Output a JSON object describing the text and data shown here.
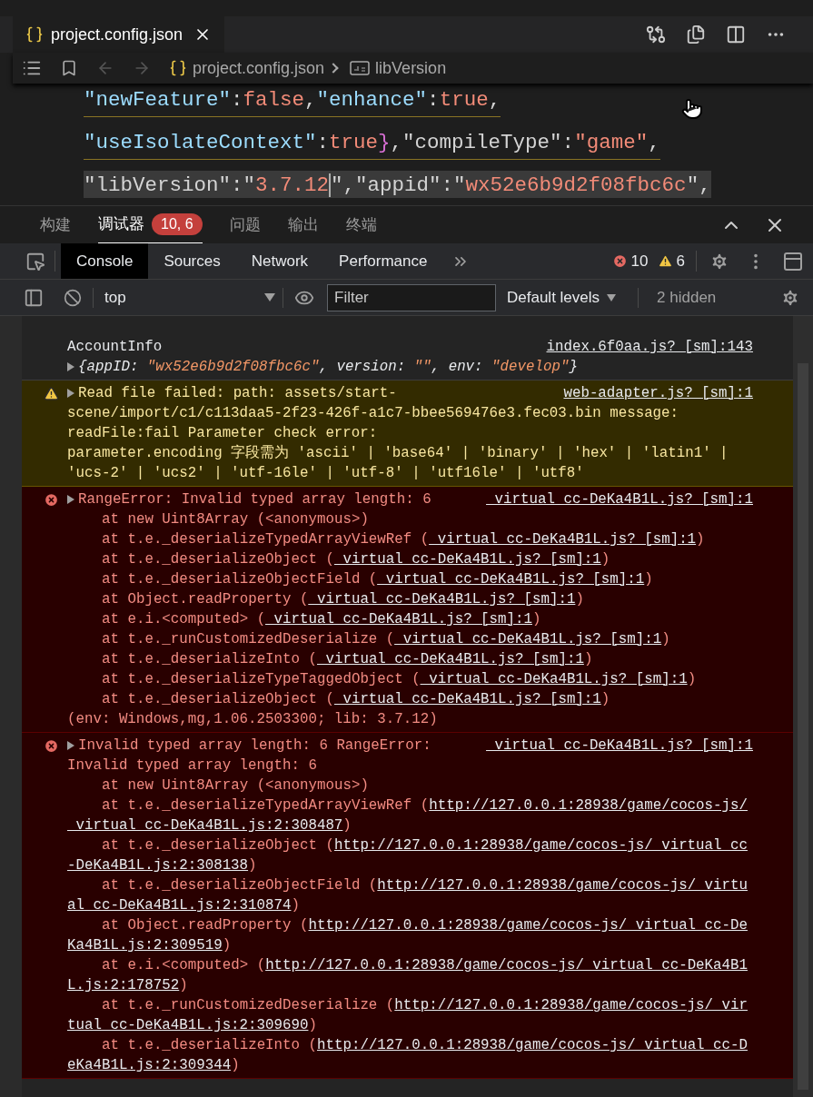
{
  "editor_tab": {
    "label": "project.config.json",
    "selected": true
  },
  "breadcrumb": {
    "file": "project.config.json",
    "symbol": "libVersion"
  },
  "code_lines": [
    {
      "highlighted": false,
      "tokens": [
        {
          "kind": "key",
          "text": "\"newFeature\""
        },
        {
          "kind": "punct",
          "text": ":"
        },
        {
          "kind": "value",
          "text": "false"
        },
        {
          "kind": "punct",
          "text": ","
        },
        {
          "kind": "key",
          "text": "\"enhance\""
        },
        {
          "kind": "punct",
          "text": ":"
        },
        {
          "kind": "value",
          "text": "true"
        },
        {
          "kind": "punct",
          "text": ","
        }
      ]
    },
    {
      "highlighted": false,
      "tokens": [
        {
          "kind": "key",
          "text": "\"useIsolateContext\""
        },
        {
          "kind": "punct",
          "text": ":"
        },
        {
          "kind": "value",
          "text": "true"
        },
        {
          "kind": "brace",
          "text": "}"
        },
        {
          "kind": "punct",
          "text": ",\"compileType\":"
        },
        {
          "kind": "value",
          "text": "\"game\""
        },
        {
          "kind": "punct",
          "text": ","
        }
      ]
    },
    {
      "highlighted": true,
      "tokens": [
        {
          "kind": "punct",
          "text": "\"libVersion\":\""
        },
        {
          "kind": "value",
          "text": "3.7.12",
          "cursor": true
        },
        {
          "kind": "punct",
          "text": "\",\"appid\":\""
        },
        {
          "kind": "value",
          "text": "wx52e6b9d2f08fbc6c"
        },
        {
          "kind": "punct",
          "text": "\","
        }
      ]
    }
  ],
  "panel_tabs": [
    {
      "label": "构建",
      "selected": false
    },
    {
      "label": "调试器",
      "selected": true,
      "badge": "10, 6"
    },
    {
      "label": "问题",
      "selected": false
    },
    {
      "label": "输出",
      "selected": false
    },
    {
      "label": "终端",
      "selected": false
    }
  ],
  "devtools_tabs": [
    {
      "label": "Console",
      "selected": true
    },
    {
      "label": "Sources",
      "selected": false
    },
    {
      "label": "Network",
      "selected": false
    },
    {
      "label": "Performance",
      "selected": false
    }
  ],
  "counts": {
    "errors": "10",
    "warnings": "6"
  },
  "filter_bar": {
    "context": "top",
    "filter_placeholder": "Filter",
    "levels": "Default levels",
    "hidden": "2 hidden"
  },
  "messages": [
    {
      "kind": "log",
      "text": "AccountInfo",
      "source": "index.6f0aa.js? [sm]:143",
      "object": [
        {
          "kind": "plain",
          "text": "{appID: "
        },
        {
          "kind": "string",
          "text": "\"wx52e6b9d2f08fbc6c\""
        },
        {
          "kind": "plain",
          "text": ", version: "
        },
        {
          "kind": "string",
          "text": "\"\""
        },
        {
          "kind": "plain",
          "text": ", env: "
        },
        {
          "kind": "string",
          "text": "\"develop\""
        },
        {
          "kind": "plain",
          "text": "}"
        }
      ]
    },
    {
      "kind": "warning",
      "text": "Read file failed: path: assets/start-",
      "continuation": "scene/import/c1/c113daa5-2f23-426f-a1c7-bbee569476e3.fec03.bin message:\nreadFile:fail Parameter check error:\nparameter.encoding 字段需为 'ascii' | 'base64' | 'binary' | 'hex' | 'latin1' | 'ucs-2' | 'ucs2' | 'utf-16le' | 'utf-8' | 'utf16le' | 'utf8'",
      "source": "web-adapter.js? [sm]:1"
    },
    {
      "kind": "error",
      "text": "RangeError: Invalid typed array length: 6",
      "source": "_virtual_cc-DeKa4B1L.js? [sm]:1",
      "frames": [
        {
          "text": "at new Uint8Array (<anonymous>)"
        },
        {
          "text": "at t.e._deserializeTypedArrayViewRef (",
          "link": "_virtual_cc-DeKa4B1L.js? [sm]:1",
          "after": ")"
        },
        {
          "text": "at t.e._deserializeObject (",
          "link": "_virtual_cc-DeKa4B1L.js? [sm]:1",
          "after": ")"
        },
        {
          "text": "at t.e._deserializeObjectField (",
          "link": "_virtual_cc-DeKa4B1L.js? [sm]:1",
          "after": ")"
        },
        {
          "text": "at Object.readProperty (",
          "link": "_virtual_cc-DeKa4B1L.js? [sm]:1",
          "after": ")"
        },
        {
          "text": "at e.i.<computed> (",
          "link": "_virtual_cc-DeKa4B1L.js? [sm]:1",
          "after": ")"
        },
        {
          "text": "at t.e._runCustomizedDeserialize (",
          "link": "_virtual_cc-DeKa4B1L.js? [sm]:1",
          "after": ")"
        },
        {
          "text": "at t.e._deserializeInto (",
          "link": "_virtual_cc-DeKa4B1L.js? [sm]:1",
          "after": ")"
        },
        {
          "text": "at t.e._deserializeTypeTaggedObject (",
          "link": "_virtual_cc-DeKa4B1L.js? [sm]:1",
          "after": ")"
        },
        {
          "text": "at t.e._deserializeObject (",
          "link": "_virtual_cc-DeKa4B1L.js? [sm]:1",
          "after": ")"
        }
      ],
      "footer": "(env: Windows,mg,1.06.2503300; lib: 3.7.12)"
    },
    {
      "kind": "error",
      "text": "Invalid typed array length: 6 RangeError:",
      "continuation": "Invalid typed array length: 6",
      "source": "_virtual_cc-DeKa4B1L.js? [sm]:1",
      "frames": [
        {
          "text": "at new Uint8Array (<anonymous>)"
        },
        {
          "text": "at t.e._deserializeTypedArrayViewRef (",
          "link": "http://127.0.0.1:28938/game/cocos-js/",
          "link_wrap": "_virtual_cc-DeKa4B1L.js:2:308487",
          "after": ")"
        },
        {
          "text": "at t.e._deserializeObject (",
          "link": "http://127.0.0.1:28938/game/cocos-js/_virtual_cc",
          "link_wrap": "-DeKa4B1L.js:2:308138",
          "after": ")"
        },
        {
          "text": "at t.e._deserializeObjectField (",
          "link": "http://127.0.0.1:28938/game/cocos-js/_virtu",
          "link_wrap": "al_cc-DeKa4B1L.js:2:310874",
          "after": ")"
        },
        {
          "text": "at Object.readProperty (",
          "link": "http://127.0.0.1:28938/game/cocos-js/_virtual_cc-De",
          "link_wrap": "Ka4B1L.js:2:309519",
          "after": ")"
        },
        {
          "text": "at e.i.<computed> (",
          "link": "http://127.0.0.1:28938/game/cocos-js/_virtual_cc-DeKa4B1",
          "link_wrap": "L.js:2:178752",
          "after": ")"
        },
        {
          "text": "at t.e._runCustomizedDeserialize (",
          "link": "http://127.0.0.1:28938/game/cocos-js/_vir",
          "link_wrap": "tual_cc-DeKa4B1L.js:2:309690",
          "after": ")"
        },
        {
          "text": "at t.e._deserializeInto (",
          "link": "http://127.0.0.1:28938/game/cocos-js/_virtual_cc-D",
          "link_wrap": "eKa4B1L.js:2:309344",
          "after": ")"
        }
      ]
    }
  ]
}
